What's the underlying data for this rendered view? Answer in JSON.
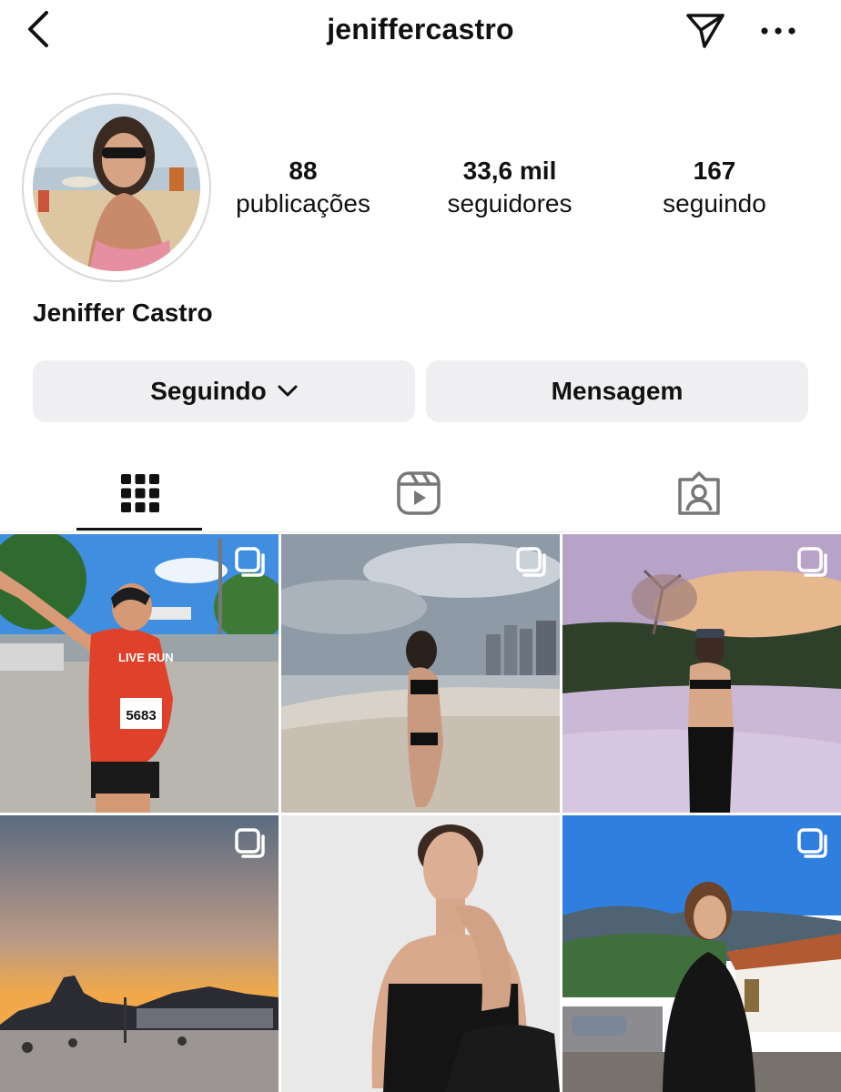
{
  "header": {
    "username": "jeniffercastro",
    "back_icon": "chevron-left-icon",
    "direct_icon": "paper-plane-icon",
    "more_icon": "more-horizontal-icon"
  },
  "profile": {
    "full_name": "Jeniffer Castro",
    "stats": {
      "posts_count": "88",
      "posts_label": "publicações",
      "followers_count": "33,6 mil",
      "followers_label": "seguidores",
      "following_count": "167",
      "following_label": "seguindo"
    }
  },
  "actions": {
    "following_label": "Seguindo",
    "message_label": "Mensagem"
  },
  "tabs": [
    {
      "name": "posts-grid",
      "icon": "grid-icon",
      "active": true
    },
    {
      "name": "reels",
      "icon": "reels-icon",
      "active": false
    },
    {
      "name": "tagged",
      "icon": "tagged-person-icon",
      "active": false
    }
  ],
  "posts": [
    {
      "type": "carousel",
      "overlay_text": "LIVE RUN",
      "bib_number": "5683"
    },
    {
      "type": "carousel"
    },
    {
      "type": "carousel"
    },
    {
      "type": "carousel"
    },
    {
      "type": "image"
    },
    {
      "type": "carousel"
    }
  ],
  "colors": {
    "button_bg": "#efeff1",
    "text": "#111111",
    "divider": "#e6e6e6"
  }
}
